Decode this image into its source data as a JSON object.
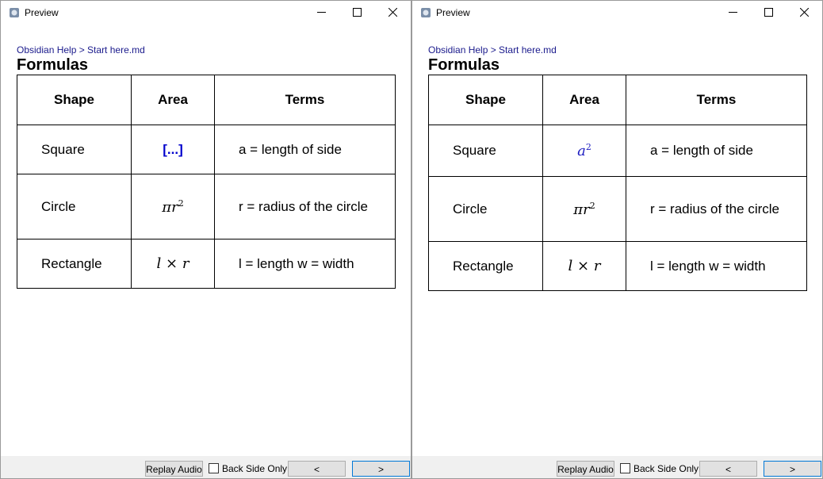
{
  "windows": [
    {
      "title": "Preview",
      "breadcrumb": "Obsidian Help > Start here.md",
      "heading": "Formulas",
      "table": {
        "headers": [
          "Shape",
          "Area",
          "Terms"
        ],
        "rows": [
          {
            "shape": "Square",
            "area_cloze": "[...]",
            "terms": "a = length of side"
          },
          {
            "shape": "Circle",
            "area_base": "πr",
            "area_sup": "2",
            "terms": "r = radius of the circle"
          },
          {
            "shape": "Rectangle",
            "area_l": "l",
            "area_op": "×",
            "area_r": "r",
            "terms": "l = length w = width"
          }
        ]
      },
      "footer": {
        "replay_label": "Replay Audio",
        "back_side_label": "Back Side Only",
        "back_side_checked": false,
        "prev_label": "<",
        "next_label": ">"
      }
    },
    {
      "title": "Preview",
      "breadcrumb": "Obsidian Help > Start here.md",
      "heading": "Formulas",
      "table": {
        "headers": [
          "Shape",
          "Area",
          "Terms"
        ],
        "rows": [
          {
            "shape": "Square",
            "area_base": "a",
            "area_sup": "2",
            "terms": "a = length of side"
          },
          {
            "shape": "Circle",
            "area_base": "πr",
            "area_sup": "2",
            "terms": "r = radius of the circle"
          },
          {
            "shape": "Rectangle",
            "area_l": "l",
            "area_op": "×",
            "area_r": "r",
            "terms": "l = length w = width"
          }
        ]
      },
      "footer": {
        "replay_label": "Replay Audio",
        "back_side_label": "Back Side Only",
        "back_side_checked": false,
        "prev_label": "<",
        "next_label": ">"
      }
    }
  ],
  "colors": {
    "link": "#1a1a8c",
    "cloze": "#0000cc",
    "accent_border": "#0078d7"
  }
}
